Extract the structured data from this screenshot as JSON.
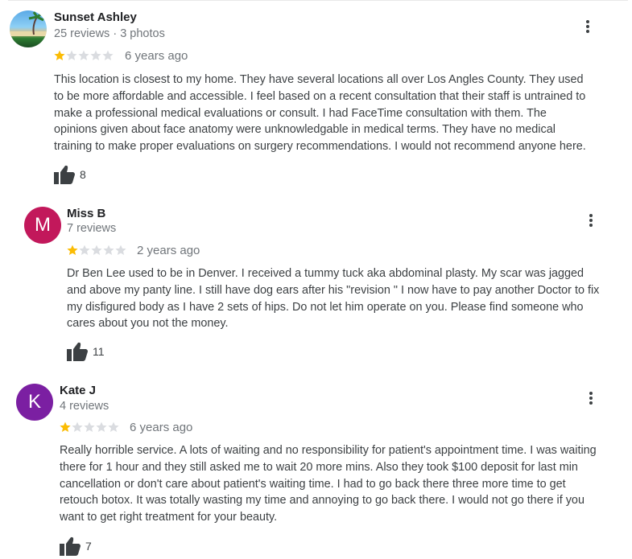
{
  "reviews": [
    {
      "name": "Sunset Ashley",
      "meta": "25 reviews · 3 photos",
      "rating": 1,
      "max_rating": 5,
      "ago": "6 years ago",
      "lines": [
        "This location is closest to my home. They have several locations all over Los Angles County. They used",
        "to be more affordable and accessible. I feel based on a recent consultation that their staff is untrained to",
        "make a professional medical evaluations  or consult. I had FaceTime consultation with them. The",
        "opinions given about face anatomy were unknowledgable in medical terms. They have no medical",
        "training to make proper evaluations on surgery recommendations. I would not recommend anyone here."
      ],
      "likes": "8"
    },
    {
      "name": "Miss B",
      "initial": "M",
      "avatar_color": "#c2185b",
      "meta": "7 reviews",
      "rating": 1,
      "max_rating": 5,
      "ago": "2 years ago",
      "lines": [
        "Dr Ben Lee used to be in Denver. I received a tummy tuck aka abdominal plasty. My scar was jagged",
        "and above my panty line. I still have dog ears after his \"revision \" I now have to pay another Doctor to fix",
        "my disfigured body as I have 2 sets of hips. Do not let him operate on you. Please find someone who",
        "cares about you not the money."
      ],
      "likes": "11"
    },
    {
      "name": "Kate J",
      "initial": "K",
      "avatar_color": "#7b1fa2",
      "meta": "4 reviews",
      "rating": 1,
      "max_rating": 5,
      "ago": "6 years ago",
      "lines": [
        "Really horrible service. A lots of waiting and no responsibility for patient's appointment time. I was waiting",
        "there for 1 hour and they still asked me to wait 20 more mins. Also they took $100 deposit for last min",
        "cancellation or don't care about patient's waiting time. I had to go back there three more time to get",
        "retouch botox. It was totally wasting my time and annoying to go back there. I would not go there if you",
        "want to get right treatment for your beauty."
      ],
      "likes": "7"
    }
  ],
  "colors": {
    "star_filled": "#fbbc04",
    "star_empty": "#dadce0",
    "icon": "#3c4043"
  },
  "icons": {
    "more": "more-vert-icon",
    "like": "thumb-up-icon",
    "star": "star-icon"
  }
}
